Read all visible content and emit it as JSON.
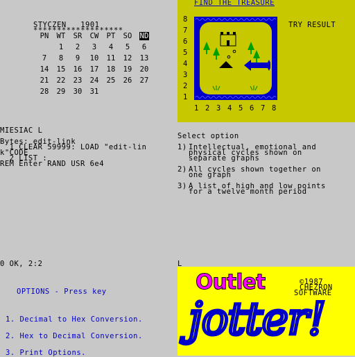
{
  "calendar": {
    "month_header": "STYCZEN   1901",
    "stars": "*******************",
    "days": [
      "PN",
      "WT",
      "SR",
      "CW",
      "PT",
      "SO",
      "ND"
    ],
    "weeks": [
      [
        "",
        "1",
        "2",
        "3",
        "4",
        "5",
        "6"
      ],
      [
        "7",
        "8",
        "9",
        "10",
        "11",
        "12",
        "13"
      ],
      [
        "14",
        "15",
        "16",
        "17",
        "18",
        "19",
        "20"
      ],
      [
        "21",
        "22",
        "23",
        "24",
        "25",
        "26",
        "27"
      ],
      [
        "28",
        "29",
        "30",
        "31",
        "",
        "",
        ""
      ]
    ]
  },
  "map": {
    "title": "FIND THE TREASURE",
    "try_result": "TRY RESULT",
    "row_numbers": [
      "8",
      "7",
      "6",
      "5",
      "4",
      "3",
      "2",
      "1"
    ],
    "col_numbers": [
      "1",
      "2",
      "3",
      "4",
      "5",
      "6",
      "7",
      "8"
    ],
    "colors": {
      "background": "#c8c800",
      "sea": "#0000c8",
      "island": "#c8c800",
      "tree": "#00a000"
    }
  },
  "basic": {
    "miesiac": "MIESIAC L",
    "bytes": "Bytes: edit-link",
    "line1": "  1 CLEAR 59999: LOAD \"edit-lin",
    "line1b": "k\"CODE",
    "line2": "  2 LIST :",
    "line3": "REM Enter RAND USR 6e4",
    "ok": "0 OK, 2:2"
  },
  "biorhythm": {
    "select": "Select option",
    "options": [
      {
        "num": "1)",
        "lines": [
          "Intellectual, emotional and",
          "physical cycles shown on",
          "separate graphs"
        ]
      },
      {
        "num": "2)",
        "lines": [
          "All cycles shown together on",
          "one graph"
        ]
      },
      {
        "num": "3)",
        "lines": [
          "A list of high and low points",
          "for a twelve month period"
        ]
      }
    ],
    "cursor": "L"
  },
  "menu": {
    "header": "OPTIONS - Press key",
    "items": [
      "1. Decimal to Hex Conversion.",
      "2. Hex to Decimal Conversion.",
      "3. Print Options."
    ],
    "color": "#0000c8"
  },
  "jotter": {
    "outlet": "Outlet",
    "jotter": "jotter!",
    "copyright": "©1987",
    "company": "CHEZRON",
    "software": "SOFTWARE",
    "colors": {
      "background": "#ffff00",
      "outlet": "#ff00ff",
      "jotter": "#0000c8"
    }
  }
}
